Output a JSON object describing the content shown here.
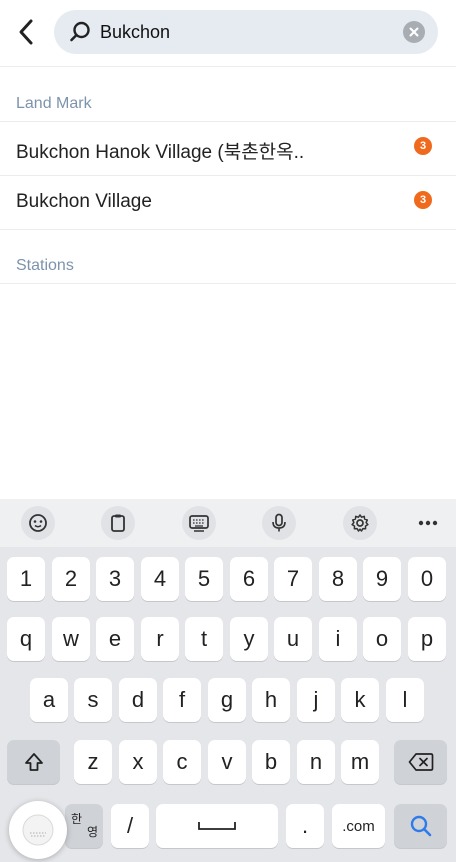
{
  "search": {
    "value": "Bukchon",
    "placeholder": ""
  },
  "sections": {
    "landmark_title": "Land Mark",
    "stations_title": "Stations"
  },
  "results": [
    {
      "label": "Bukchon Hanok Village (북촌한옥..",
      "badge": "3"
    },
    {
      "label": "Bukchon Village",
      "badge": "3"
    }
  ],
  "keyboard": {
    "numbers": [
      "1",
      "2",
      "3",
      "4",
      "5",
      "6",
      "7",
      "8",
      "9",
      "0"
    ],
    "row1": [
      "q",
      "w",
      "e",
      "r",
      "t",
      "y",
      "u",
      "i",
      "o",
      "p"
    ],
    "row2": [
      "a",
      "s",
      "d",
      "f",
      "g",
      "h",
      "j",
      "k",
      "l"
    ],
    "row3": [
      "z",
      "x",
      "c",
      "v",
      "b",
      "n",
      "m"
    ],
    "lang_key_top": "한",
    "lang_key_bottom": "영",
    "slash_key": "/",
    "period_key": ".",
    "dotcom_key": ".com"
  },
  "colors": {
    "accent_badge": "#ef6a1c",
    "section_header": "#7d93ad",
    "search_bg": "#e6ebf2",
    "search_key_icon": "#2f7bea"
  },
  "icons": {
    "back": "chevron-left-icon",
    "search": "search-icon",
    "clear": "clear-circle-icon",
    "toolbar": [
      "emoji-icon",
      "clipboard-icon",
      "keyboard-layout-icon",
      "microphone-icon",
      "gear-icon",
      "more-icon"
    ]
  }
}
